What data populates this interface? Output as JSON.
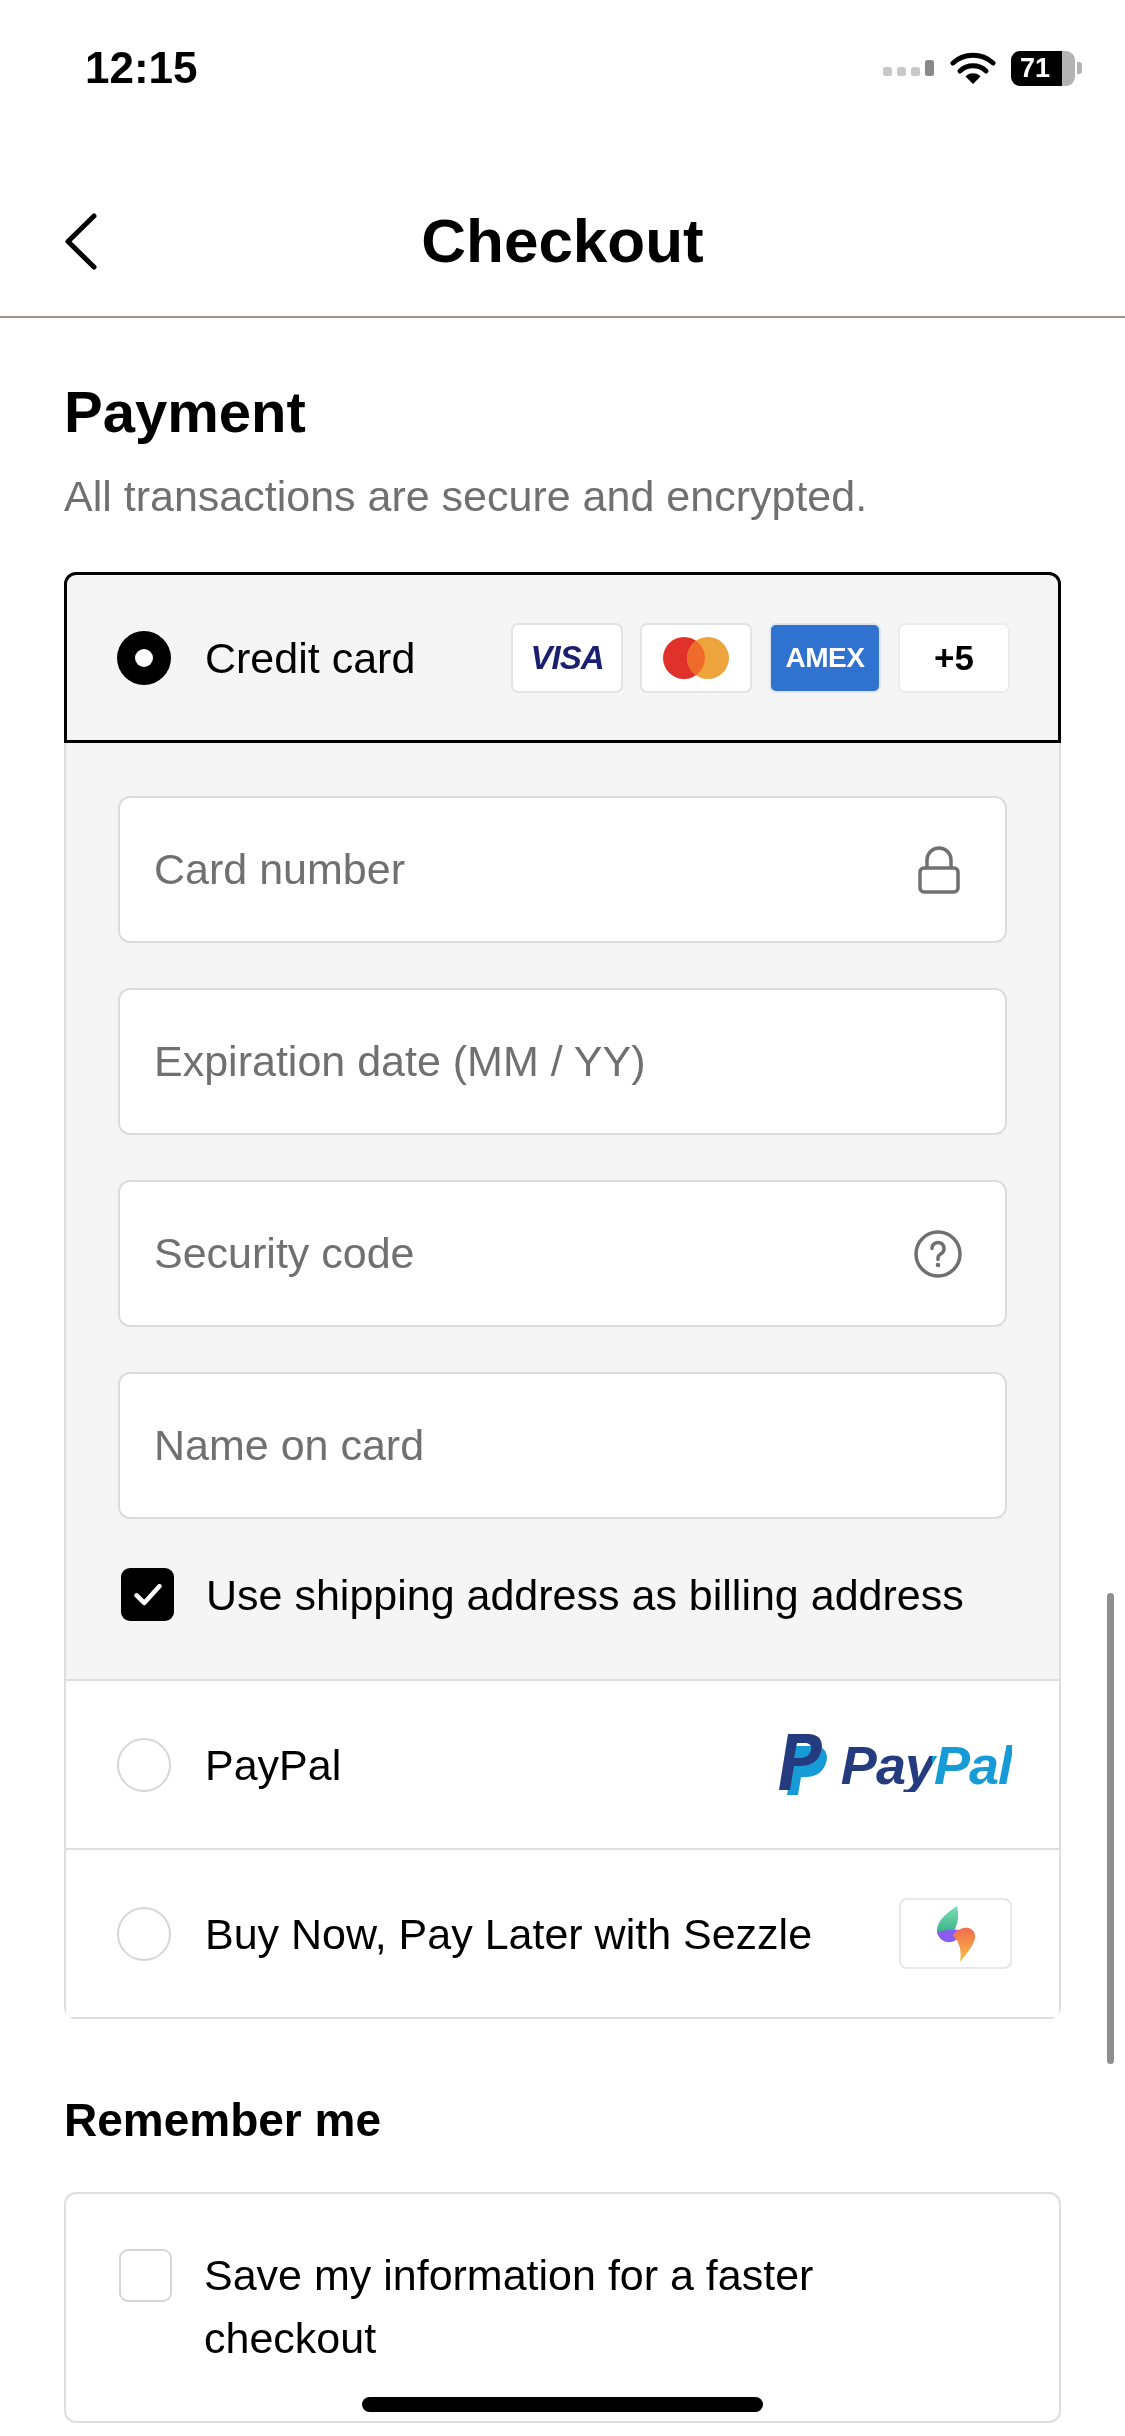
{
  "status_bar": {
    "time": "12:15",
    "battery": "71"
  },
  "header": {
    "title": "Checkout"
  },
  "payment": {
    "title": "Payment",
    "subtitle": "All transactions are secure and encrypted.",
    "methods": [
      {
        "kind": "card",
        "label": "Credit card",
        "selected": true,
        "brands": [
          {
            "kind": "visa",
            "label": "VISA"
          },
          {
            "kind": "mastercard"
          },
          {
            "kind": "amex",
            "label": "AMEX"
          },
          {
            "kind": "more",
            "label": "+5"
          }
        ],
        "fields": [
          {
            "kind": "card_number",
            "placeholder": "Card number"
          },
          {
            "kind": "expiry",
            "placeholder": "Expiration date (MM / YY)"
          },
          {
            "kind": "security_code",
            "placeholder": "Security code"
          },
          {
            "kind": "name",
            "placeholder": "Name on card"
          }
        ],
        "billing": {
          "label": "Use shipping address as billing address",
          "checked": true
        }
      },
      {
        "kind": "paypal",
        "label": "PayPal",
        "selected": false,
        "logo_text": "PayPal"
      },
      {
        "kind": "sezzle",
        "label": "Buy Now, Pay Later with Sezzle",
        "selected": false
      }
    ]
  },
  "remember_me": {
    "title": "Remember me",
    "option": {
      "label": "Save my information for a faster checkout",
      "checked": false
    }
  }
}
